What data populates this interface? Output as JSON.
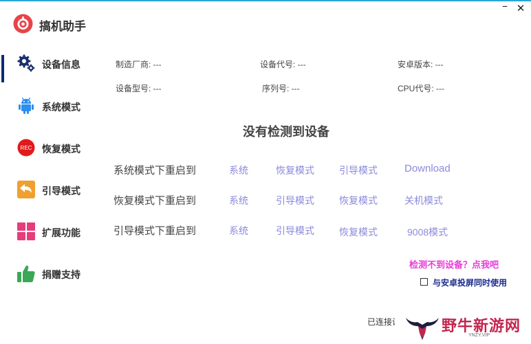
{
  "app": {
    "title": "搞机助手",
    "minimize": "–",
    "close": "✕"
  },
  "sidebar": {
    "items": [
      {
        "label": "设备信息",
        "icon": "gear-icon",
        "active": true
      },
      {
        "label": "系统模式",
        "icon": "android-icon"
      },
      {
        "label": "恢复模式",
        "icon": "rec-icon"
      },
      {
        "label": "引导模式",
        "icon": "back-arrow-icon"
      },
      {
        "label": "扩展功能",
        "icon": "grid-icon"
      },
      {
        "label": "捐赠支持",
        "icon": "thumbs-up-icon"
      }
    ],
    "rec_text": "REC"
  },
  "device_info": {
    "manufacturer": "制造厂商: ---",
    "device_code": "设备代号: ---",
    "android_version": "安卓版本: ---",
    "model": "设备型号: ---",
    "serial": "序列号: ---",
    "cpu": "CPU代号: ---"
  },
  "status_message": "没有检测到设备",
  "reboot_rows": [
    {
      "label": "系统模式下重启到",
      "actions": [
        "系统",
        "恢复模式",
        "引导模式",
        "Download"
      ]
    },
    {
      "label": "恢复模式下重启到",
      "actions": [
        "系统",
        "引导模式",
        "恢复模式",
        "关机模式"
      ]
    },
    {
      "label": "引导模式下重启到",
      "actions": [
        "系统",
        "引导模式",
        "恢复模式",
        "9008模式"
      ]
    }
  ],
  "help_link": "检测不到设备？点我吧",
  "checkbox_label": "与安卓投屏同时使用",
  "connection_status": "已连接设备",
  "watermark": {
    "text": "野牛新游网",
    "sub": "YNZY.VIP"
  },
  "colors": {
    "accent_bar": "#0c2a73",
    "link": "#8a8adb",
    "help_link": "#e63dd7",
    "logo_red": "#e8434a",
    "android_blue": "#2b8ef0",
    "rec_red": "#e11b1b",
    "arrow_orange": "#f0a030",
    "grid_pink": "#e63d7a",
    "thumb_green": "#3aa856"
  }
}
